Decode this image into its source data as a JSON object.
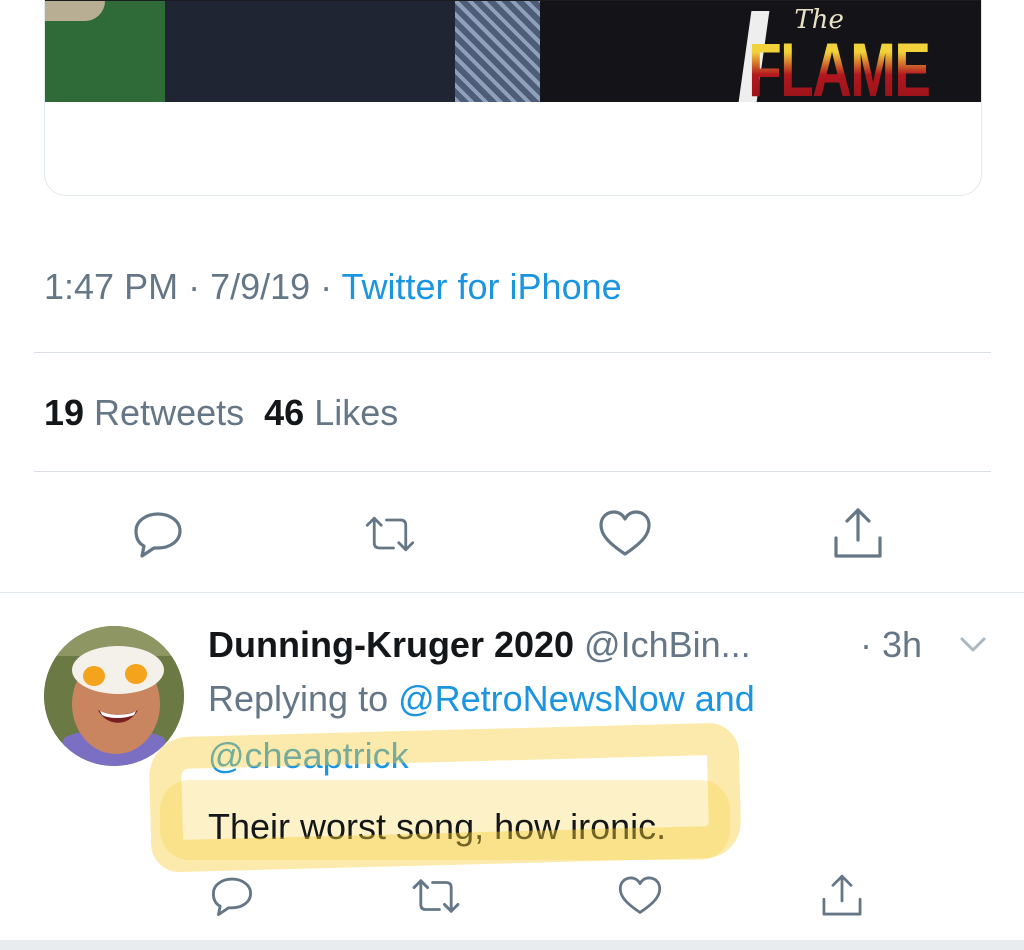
{
  "media": {
    "logo_small": "The",
    "logo_large": "FLAME"
  },
  "tweet": {
    "time": "1:47 PM",
    "sep1": " · ",
    "date": "7/9/19",
    "sep2": " · ",
    "source": "Twitter for iPhone",
    "retweets_count": "19",
    "retweets_label": " Retweets",
    "likes_count": "46",
    "likes_label": " Likes"
  },
  "reply": {
    "name": "Dunning-Kruger 2020",
    "handle": " @IchBin...",
    "time": "· 3h",
    "replying_prefix": "Replying to ",
    "mention1": "@RetroNewsNow",
    "and": " and",
    "mention2": "@cheaptrick",
    "text": "Their worst song, how ironic."
  },
  "icons": {
    "reply": "reply-icon",
    "retweet": "retweet-icon",
    "like": "heart-icon",
    "share": "share-icon",
    "more": "chevron-down-icon"
  },
  "colors": {
    "link": "#1b95e0",
    "muted": "#657786",
    "text": "#14171a",
    "highlight": "#f5cd37"
  }
}
